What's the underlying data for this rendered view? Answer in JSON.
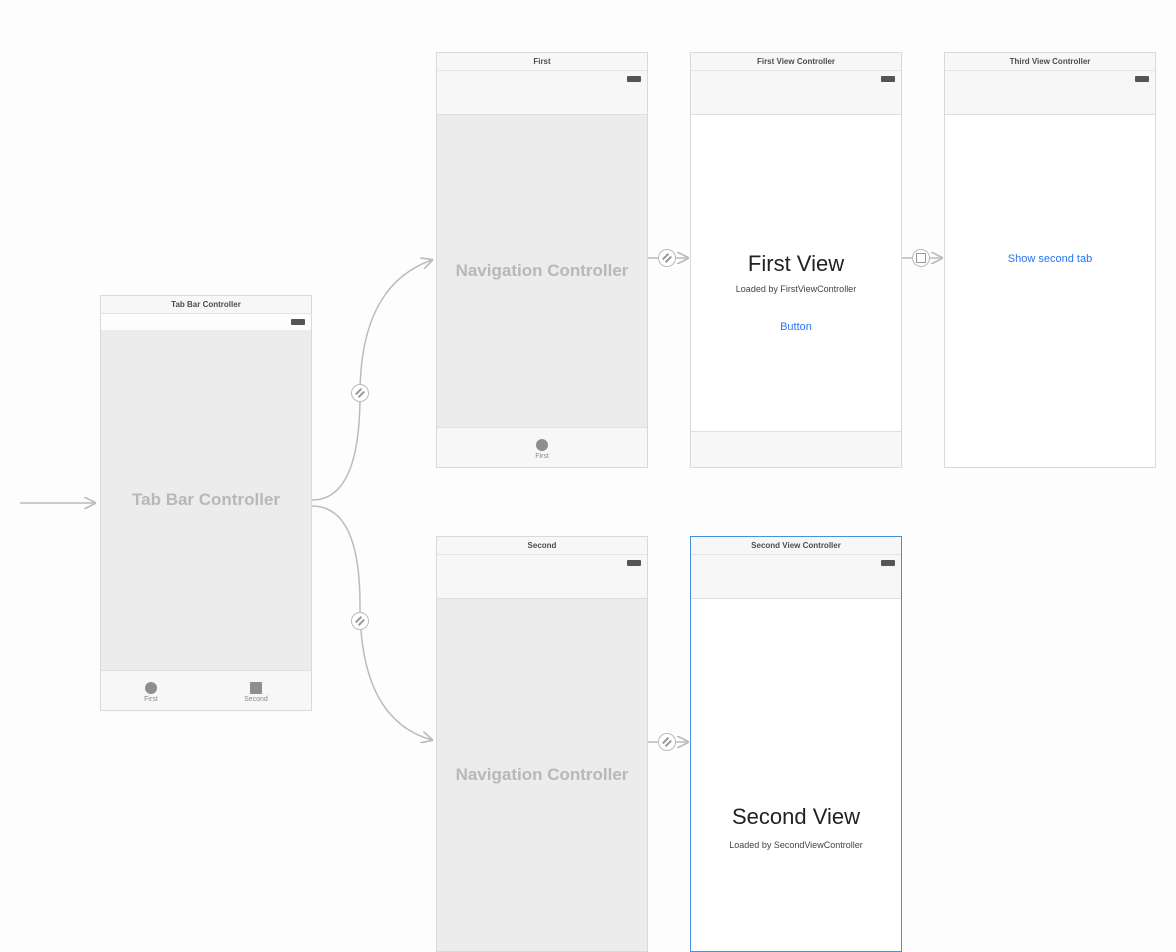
{
  "tabBar": {
    "header": "Tab Bar Controller",
    "bodyTitle": "Tab Bar Controller",
    "tabs": [
      {
        "label": "First"
      },
      {
        "label": "Second"
      }
    ]
  },
  "navFirst": {
    "header": "First",
    "bodyTitle": "Navigation Controller",
    "tab": {
      "label": "First"
    }
  },
  "navSecond": {
    "header": "Second",
    "bodyTitle": "Navigation Controller"
  },
  "firstView": {
    "header": "First View Controller",
    "title": "First View",
    "subtitle": "Loaded by FirstViewController",
    "button": "Button"
  },
  "thirdView": {
    "header": "Third View Controller",
    "link": "Show second tab"
  },
  "secondView": {
    "header": "Second View Controller",
    "title": "Second View",
    "subtitle": "Loaded by SecondViewController"
  },
  "colors": {
    "link": "#2676f6",
    "dim": "#b8b8b8",
    "border": "#d9d9d9",
    "selected": "#4a90e2"
  }
}
